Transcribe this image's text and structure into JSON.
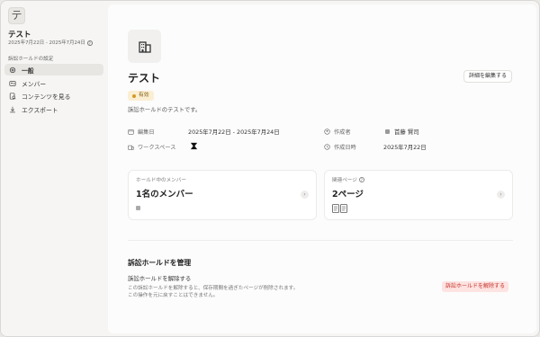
{
  "app": {
    "icon_glyph": "テ"
  },
  "sidebar": {
    "title": "テスト",
    "dates": "2025年7月22日 - 2025年7月24日",
    "section_label": "訴訟ホールドの設定",
    "items": [
      {
        "label": "一般",
        "icon": "gear-icon",
        "active": true
      },
      {
        "label": "メンバー",
        "icon": "members-icon",
        "active": false
      },
      {
        "label": "コンテンツを見る",
        "icon": "document-search-icon",
        "active": false
      },
      {
        "label": "エクスポート",
        "icon": "download-icon",
        "active": false
      }
    ]
  },
  "header": {
    "title": "テスト",
    "edit_button": "詳細を編集する",
    "status": "有効",
    "description": "訴訟ホールドのテストです。"
  },
  "properties": {
    "edit_date_label": "編集日",
    "edit_date_value": "2025年7月22日 - 2025年7月24日",
    "workspace_label": "ワークスペース",
    "creator_label": "作成者",
    "creator_value": "首藤 賢司",
    "created_at_label": "作成日時",
    "created_at_value": "2025年7月22日"
  },
  "cards": {
    "members_label": "ホールド中のメンバー",
    "members_value": "1名のメンバー",
    "pages_label": "関連ページ",
    "pages_value": "2ページ"
  },
  "manage": {
    "title": "訴訟ホールドを管理",
    "release_title": "訴訟ホールドを解除する",
    "release_desc_1": "この訴訟ホールドを解除すると、保存期間を過ぎたページが削除されます。",
    "release_desc_2": "この操作を元に戻すことはできません。",
    "release_button": "訴訟ホールドを解除する"
  },
  "colors": {
    "badge_bg": "#fbeed2",
    "badge_dot": "#d39a28",
    "danger_bg": "#fde3e1",
    "danger_text": "#c4322a"
  }
}
